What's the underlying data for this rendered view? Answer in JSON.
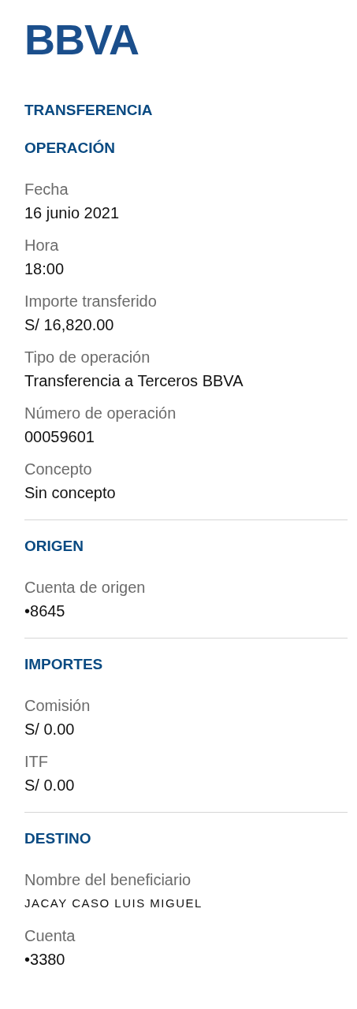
{
  "logo": "BBVA",
  "title": "TRANSFERENCIA",
  "sections": [
    {
      "heading": "OPERACIÓN",
      "fields": [
        {
          "label": "Fecha",
          "value": "16 junio 2021",
          "kind": "text"
        },
        {
          "label": "Hora",
          "value": "18:00",
          "kind": "text"
        },
        {
          "label": "Importe transferido",
          "value": "S/ 16,820.00",
          "kind": "text"
        },
        {
          "label": "Tipo de operación",
          "value": "Transferencia a Terceros BBVA",
          "kind": "text"
        },
        {
          "label": "Número de operación",
          "value": "00059601",
          "kind": "text"
        },
        {
          "label": "Concepto",
          "value": "Sin concepto",
          "kind": "text"
        }
      ]
    },
    {
      "heading": "ORIGEN",
      "fields": [
        {
          "label": "Cuenta de origen",
          "value": "•8645",
          "kind": "text"
        }
      ]
    },
    {
      "heading": "IMPORTES",
      "fields": [
        {
          "label": "Comisión",
          "value": "S/ 0.00",
          "kind": "text"
        },
        {
          "label": "ITF",
          "value": "S/ 0.00",
          "kind": "text"
        }
      ]
    },
    {
      "heading": "DESTINO",
      "fields": [
        {
          "label": "Nombre del beneficiario",
          "value": "JACAY CASO LUIS MIGUEL",
          "kind": "name"
        },
        {
          "label": "Cuenta",
          "value": "•3380",
          "kind": "text"
        }
      ]
    }
  ]
}
